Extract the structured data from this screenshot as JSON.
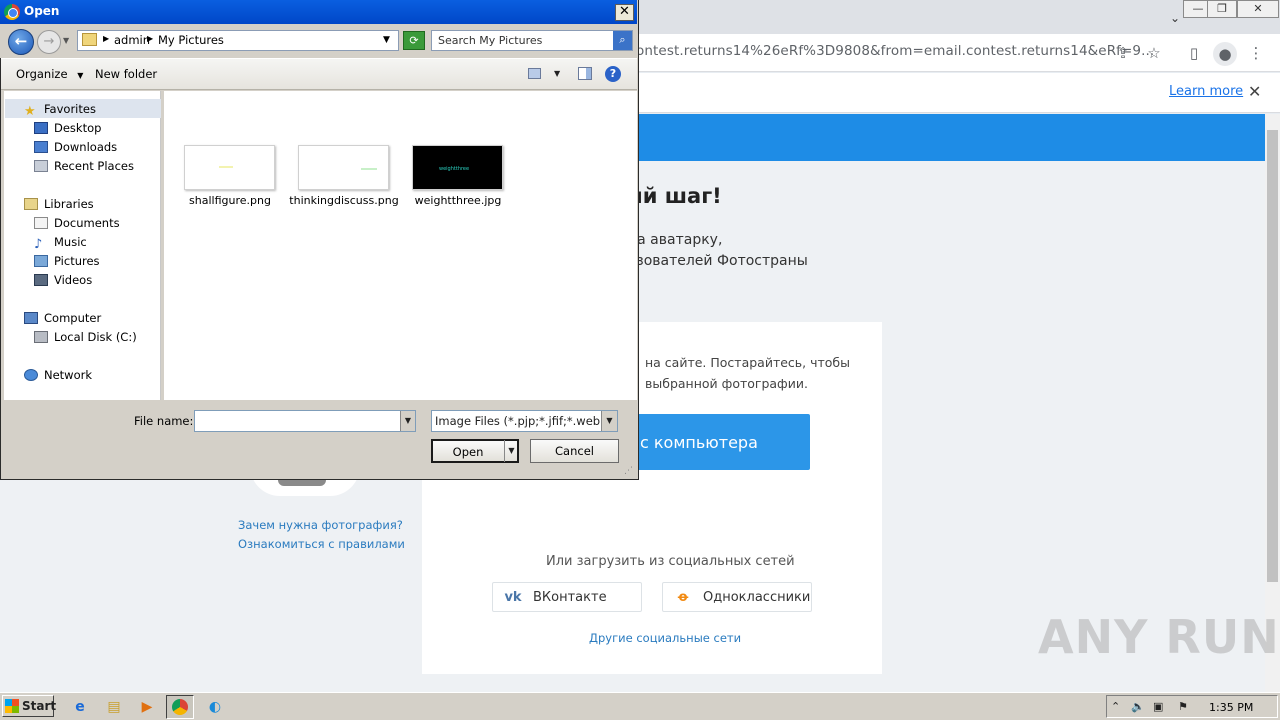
{
  "browser": {
    "url_fragment": "ontest.returns14%26eRf%3D9808&from=email.contest.returns14&eRf=9...",
    "infobar_link": "Learn more",
    "page": {
      "heading_partial": "ий шаг!",
      "subtitle_line1": "на аватарку,",
      "subtitle_line2": "ьзователей Фотостраны",
      "card_text_line1": "на сайте. Постарайтесь, чтобы",
      "card_text_line2": "выбранной фотографии.",
      "upload_button": "с компьютера",
      "or_social": "Или загрузить из социальных сетей",
      "vk_label": "ВКонтакте",
      "ok_label": "Одноклассники",
      "other_social": "Другие социальные сети",
      "why_photo_link": "Зачем нужна фотография?",
      "rules_link": "Ознакомиться с правилами"
    },
    "watermark": "ANY RUN"
  },
  "dialog": {
    "title": "Open",
    "address": {
      "crumbs": [
        "admin",
        "My Pictures"
      ]
    },
    "search_placeholder": "Search My Pictures",
    "commands": {
      "organize": "Organize",
      "new_folder": "New folder"
    },
    "nav": {
      "favorites": "Favorites",
      "desktop": "Desktop",
      "downloads": "Downloads",
      "recent_places": "Recent Places",
      "libraries": "Libraries",
      "documents": "Documents",
      "music": "Music",
      "pictures": "Pictures",
      "videos": "Videos",
      "computer": "Computer",
      "local_disk": "Local Disk (C:)",
      "network": "Network"
    },
    "files": [
      {
        "name": "shallfigure.png"
      },
      {
        "name": "thinkingdiscuss.png"
      },
      {
        "name": "weightthree.jpg",
        "thumb_text": "weightthree"
      }
    ],
    "file_name_label": "File name:",
    "file_name_value": "",
    "file_type": "Image Files (*.pjp;*.jfif;*.webp;*",
    "open_button": "Open",
    "cancel_button": "Cancel"
  },
  "taskbar": {
    "start_label": "Start",
    "clock": "1:35 PM"
  },
  "colors": {
    "dialog_title": "#0050d8",
    "brand_blue": "#1e8ce6",
    "link_blue": "#2a7bbf"
  }
}
